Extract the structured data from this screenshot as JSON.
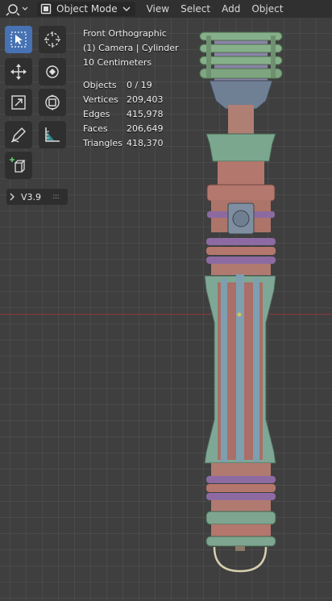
{
  "header": {
    "mode_label": "Object Mode",
    "menus": [
      "View",
      "Select",
      "Add",
      "Object"
    ]
  },
  "overlay": {
    "view_name": "Front Orthographic",
    "collection_line": "(1) Camera | Cylinder",
    "scale_line": "10 Centimeters"
  },
  "stats": [
    {
      "label": "Objects",
      "value": "0 / 19"
    },
    {
      "label": "Vertices",
      "value": "209,403"
    },
    {
      "label": "Edges",
      "value": "415,978"
    },
    {
      "label": "Faces",
      "value": "206,649"
    },
    {
      "label": "Triangles",
      "value": "418,370"
    }
  ],
  "version_label": "V3.9",
  "tools": [
    {
      "name": "select-box-tool",
      "icon": "cursor-box-icon",
      "active": true
    },
    {
      "name": "cursor-tool",
      "icon": "crosshair-icon",
      "active": false
    },
    {
      "name": "move-tool",
      "icon": "move-arrows-icon",
      "active": false
    },
    {
      "name": "rotate-tool",
      "icon": "rotate-icon",
      "active": false
    },
    {
      "name": "scale-tool",
      "icon": "scale-icon",
      "active": false
    },
    {
      "name": "transform-tool",
      "icon": "transform-icon",
      "active": false
    },
    {
      "name": "annotate-tool",
      "icon": "pencil-icon",
      "active": false
    },
    {
      "name": "measure-tool",
      "icon": "ruler-icon",
      "active": false
    },
    {
      "name": "add-cube-tool",
      "icon": "add-cube-icon",
      "active": false
    }
  ],
  "colors": {
    "active_tool": "#4772b3",
    "header_bg": "#303030",
    "viewport_bg": "#3f3f3f",
    "x_axis": "#8b3a3a",
    "mesh_copper": "#b5796f",
    "mesh_teal": "#7ea590",
    "mesh_purple": "#8c6aa0",
    "mesh_steel": "#7f8ea0"
  }
}
